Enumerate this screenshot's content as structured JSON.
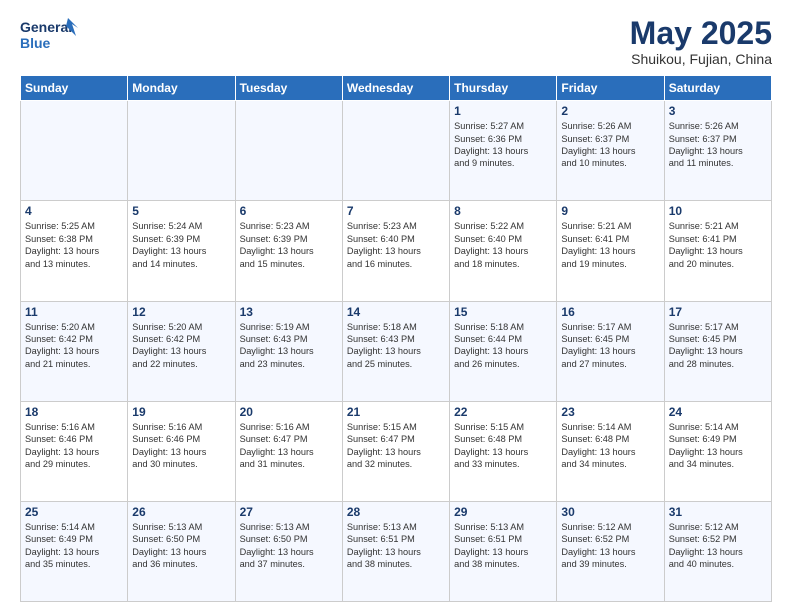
{
  "header": {
    "logo_line1": "General",
    "logo_line2": "Blue",
    "title": "May 2025",
    "subtitle": "Shuikou, Fujian, China"
  },
  "days_of_week": [
    "Sunday",
    "Monday",
    "Tuesday",
    "Wednesday",
    "Thursday",
    "Friday",
    "Saturday"
  ],
  "weeks": [
    [
      {
        "day": "",
        "info": ""
      },
      {
        "day": "",
        "info": ""
      },
      {
        "day": "",
        "info": ""
      },
      {
        "day": "",
        "info": ""
      },
      {
        "day": "1",
        "info": "Sunrise: 5:27 AM\nSunset: 6:36 PM\nDaylight: 13 hours\nand 9 minutes."
      },
      {
        "day": "2",
        "info": "Sunrise: 5:26 AM\nSunset: 6:37 PM\nDaylight: 13 hours\nand 10 minutes."
      },
      {
        "day": "3",
        "info": "Sunrise: 5:26 AM\nSunset: 6:37 PM\nDaylight: 13 hours\nand 11 minutes."
      }
    ],
    [
      {
        "day": "4",
        "info": "Sunrise: 5:25 AM\nSunset: 6:38 PM\nDaylight: 13 hours\nand 13 minutes."
      },
      {
        "day": "5",
        "info": "Sunrise: 5:24 AM\nSunset: 6:39 PM\nDaylight: 13 hours\nand 14 minutes."
      },
      {
        "day": "6",
        "info": "Sunrise: 5:23 AM\nSunset: 6:39 PM\nDaylight: 13 hours\nand 15 minutes."
      },
      {
        "day": "7",
        "info": "Sunrise: 5:23 AM\nSunset: 6:40 PM\nDaylight: 13 hours\nand 16 minutes."
      },
      {
        "day": "8",
        "info": "Sunrise: 5:22 AM\nSunset: 6:40 PM\nDaylight: 13 hours\nand 18 minutes."
      },
      {
        "day": "9",
        "info": "Sunrise: 5:21 AM\nSunset: 6:41 PM\nDaylight: 13 hours\nand 19 minutes."
      },
      {
        "day": "10",
        "info": "Sunrise: 5:21 AM\nSunset: 6:41 PM\nDaylight: 13 hours\nand 20 minutes."
      }
    ],
    [
      {
        "day": "11",
        "info": "Sunrise: 5:20 AM\nSunset: 6:42 PM\nDaylight: 13 hours\nand 21 minutes."
      },
      {
        "day": "12",
        "info": "Sunrise: 5:20 AM\nSunset: 6:42 PM\nDaylight: 13 hours\nand 22 minutes."
      },
      {
        "day": "13",
        "info": "Sunrise: 5:19 AM\nSunset: 6:43 PM\nDaylight: 13 hours\nand 23 minutes."
      },
      {
        "day": "14",
        "info": "Sunrise: 5:18 AM\nSunset: 6:43 PM\nDaylight: 13 hours\nand 25 minutes."
      },
      {
        "day": "15",
        "info": "Sunrise: 5:18 AM\nSunset: 6:44 PM\nDaylight: 13 hours\nand 26 minutes."
      },
      {
        "day": "16",
        "info": "Sunrise: 5:17 AM\nSunset: 6:45 PM\nDaylight: 13 hours\nand 27 minutes."
      },
      {
        "day": "17",
        "info": "Sunrise: 5:17 AM\nSunset: 6:45 PM\nDaylight: 13 hours\nand 28 minutes."
      }
    ],
    [
      {
        "day": "18",
        "info": "Sunrise: 5:16 AM\nSunset: 6:46 PM\nDaylight: 13 hours\nand 29 minutes."
      },
      {
        "day": "19",
        "info": "Sunrise: 5:16 AM\nSunset: 6:46 PM\nDaylight: 13 hours\nand 30 minutes."
      },
      {
        "day": "20",
        "info": "Sunrise: 5:16 AM\nSunset: 6:47 PM\nDaylight: 13 hours\nand 31 minutes."
      },
      {
        "day": "21",
        "info": "Sunrise: 5:15 AM\nSunset: 6:47 PM\nDaylight: 13 hours\nand 32 minutes."
      },
      {
        "day": "22",
        "info": "Sunrise: 5:15 AM\nSunset: 6:48 PM\nDaylight: 13 hours\nand 33 minutes."
      },
      {
        "day": "23",
        "info": "Sunrise: 5:14 AM\nSunset: 6:48 PM\nDaylight: 13 hours\nand 34 minutes."
      },
      {
        "day": "24",
        "info": "Sunrise: 5:14 AM\nSunset: 6:49 PM\nDaylight: 13 hours\nand 34 minutes."
      }
    ],
    [
      {
        "day": "25",
        "info": "Sunrise: 5:14 AM\nSunset: 6:49 PM\nDaylight: 13 hours\nand 35 minutes."
      },
      {
        "day": "26",
        "info": "Sunrise: 5:13 AM\nSunset: 6:50 PM\nDaylight: 13 hours\nand 36 minutes."
      },
      {
        "day": "27",
        "info": "Sunrise: 5:13 AM\nSunset: 6:50 PM\nDaylight: 13 hours\nand 37 minutes."
      },
      {
        "day": "28",
        "info": "Sunrise: 5:13 AM\nSunset: 6:51 PM\nDaylight: 13 hours\nand 38 minutes."
      },
      {
        "day": "29",
        "info": "Sunrise: 5:13 AM\nSunset: 6:51 PM\nDaylight: 13 hours\nand 38 minutes."
      },
      {
        "day": "30",
        "info": "Sunrise: 5:12 AM\nSunset: 6:52 PM\nDaylight: 13 hours\nand 39 minutes."
      },
      {
        "day": "31",
        "info": "Sunrise: 5:12 AM\nSunset: 6:52 PM\nDaylight: 13 hours\nand 40 minutes."
      }
    ]
  ]
}
